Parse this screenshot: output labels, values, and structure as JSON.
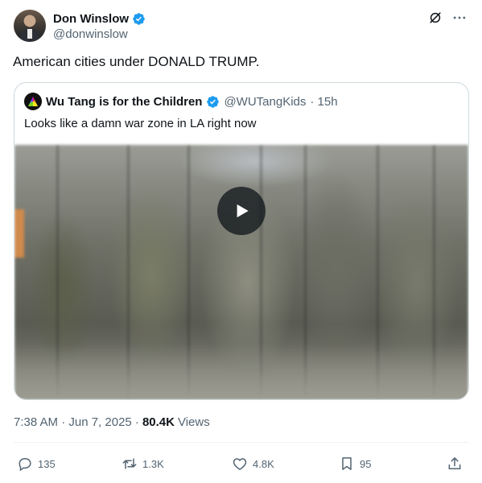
{
  "author": {
    "name": "Don Winslow",
    "handle": "@donwinslow"
  },
  "tweet": {
    "text": "American cities under DONALD TRUMP."
  },
  "quote": {
    "name": "Wu Tang is for the Children",
    "handle": "@WUTangKids",
    "time": "· 15h",
    "text": "Looks like a damn war zone in LA right now"
  },
  "meta": {
    "time": "7:38 AM · Jun 7, 2025 ·",
    "views_count": "80.4K",
    "views_label": "Views"
  },
  "actions": {
    "replies": "135",
    "reposts": "1.3K",
    "likes": "4.8K",
    "bookmarks": "95"
  },
  "colors": {
    "verified": "#1d9bf0",
    "text_secondary": "#536471",
    "text_primary": "#0f1419",
    "border": "#cfd9de"
  },
  "icons": [
    "verified-badge-icon",
    "grok-icon",
    "more-icon",
    "play-icon",
    "reply-icon",
    "repost-icon",
    "like-icon",
    "bookmark-icon",
    "share-icon"
  ]
}
